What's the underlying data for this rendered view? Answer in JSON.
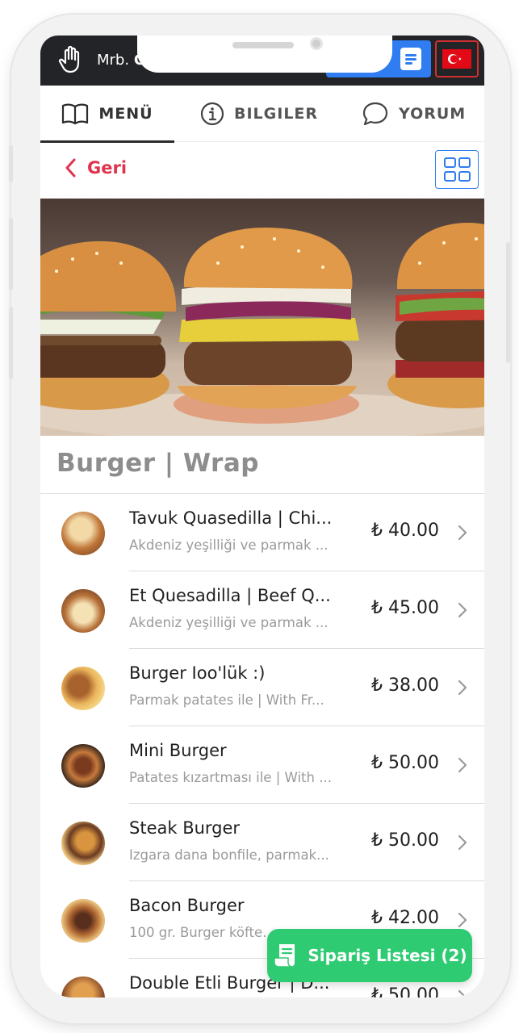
{
  "status_bar": {
    "greeting": "Mrb.",
    "greeting_partial": "C",
    "blue_button_partial": "p",
    "flag": "turkey-flag"
  },
  "tabs": [
    {
      "label": "MENÜ",
      "icon": "book-icon",
      "active": true
    },
    {
      "label": "BILGILER",
      "icon": "info-icon",
      "active": false
    },
    {
      "label": "YORUM",
      "icon": "comment-icon",
      "active": false
    }
  ],
  "nav": {
    "back_label": "Geri",
    "view_toggle_icon": "grid-icon"
  },
  "category": {
    "title": "Burger | Wrap"
  },
  "items": [
    {
      "name": "Tavuk Quasedilla | Chi...",
      "desc": "Akdeniz yeşilliği ve parmak ...",
      "price": "₺ 40.00"
    },
    {
      "name": "Et Quesadilla | Beef Q...",
      "desc": "Akdeniz yeşilliği ve parmak ...",
      "price": "₺ 45.00"
    },
    {
      "name": "Burger Ioo'lük :)",
      "desc": "Parmak patates ile | With Fr...",
      "price": "₺ 38.00"
    },
    {
      "name": "Mini Burger",
      "desc": "Patates kızartması ile | With ...",
      "price": "₺ 50.00"
    },
    {
      "name": "Steak Burger",
      "desc": "Izgara dana bonfile, parmak...",
      "price": "₺ 50.00"
    },
    {
      "name": "Bacon Burger",
      "desc": "100 gr. Burger köfte...",
      "price": "₺ 42.00"
    },
    {
      "name": "Double Etli Burger | D...",
      "desc": "",
      "price": "₺ 50.00"
    }
  ],
  "order_button": {
    "label": "Sipariş Listesi (2)",
    "icon": "receipt-icon"
  },
  "colors": {
    "accent_red": "#e0344e",
    "accent_blue": "#2f7df0",
    "order_green": "#2ecb72",
    "status_dark": "#232428"
  }
}
